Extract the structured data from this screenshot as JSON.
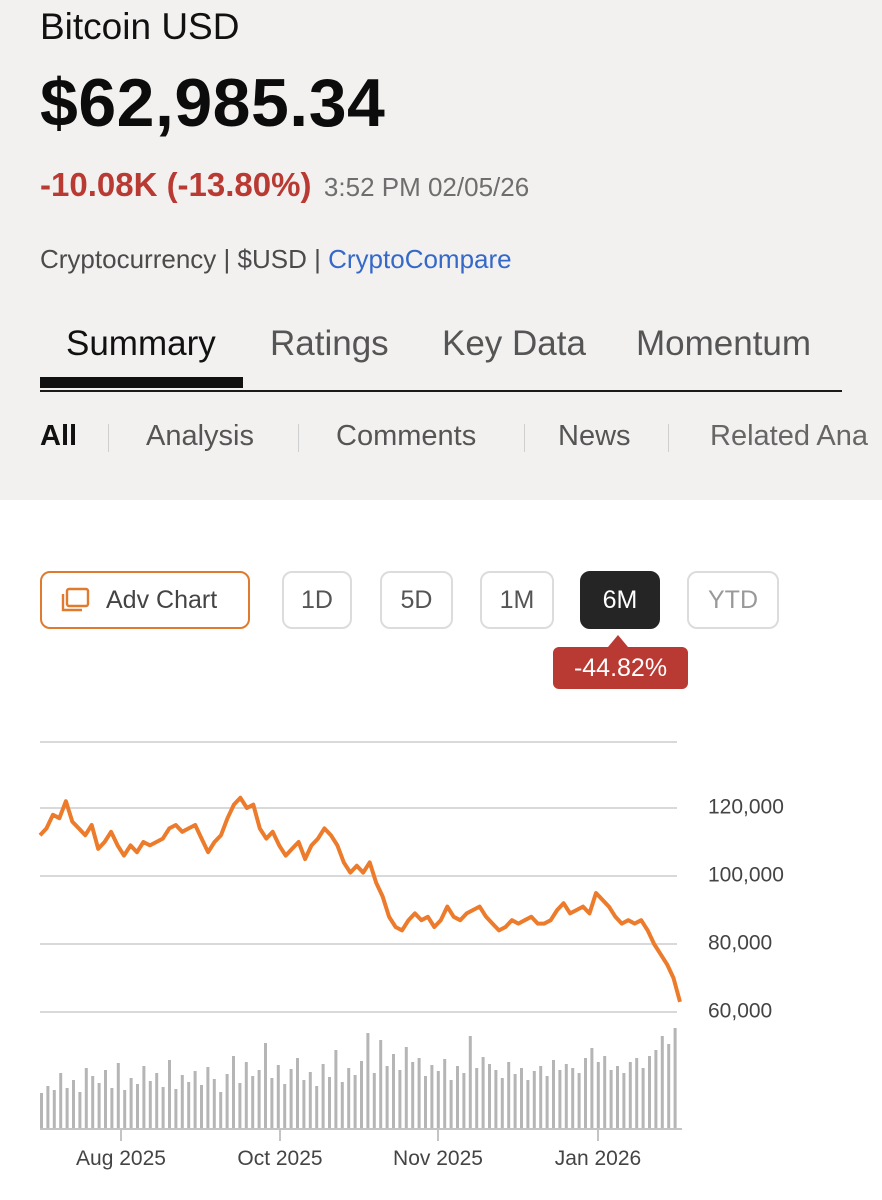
{
  "header": {
    "asset_name": "Bitcoin USD",
    "price": "$62,985.34",
    "change": "-10.08K (-13.80%)",
    "timestamp": "3:52 PM 02/05/26",
    "category": "Cryptocurrency",
    "currency": "$USD",
    "source": "CryptoCompare",
    "separator": "|"
  },
  "tabs": [
    {
      "label": "Summary",
      "active": true
    },
    {
      "label": "Ratings"
    },
    {
      "label": "Key Data"
    },
    {
      "label": "Momentum"
    }
  ],
  "subtabs": [
    {
      "label": "All",
      "active": true
    },
    {
      "label": "Analysis"
    },
    {
      "label": "Comments"
    },
    {
      "label": "News"
    },
    {
      "label": "Related Ana"
    }
  ],
  "range_controls": {
    "adv_chart_label": "Adv Chart",
    "adv_chart_icon": "chart-window-icon",
    "ranges": [
      "1D",
      "5D",
      "1M",
      "6M",
      "YTD"
    ],
    "selected": "6M",
    "period_change": "-44.82%"
  },
  "colors": {
    "negative": "#b93a33",
    "accent": "#e07a2e",
    "link": "#3568c8",
    "line": "#ec7b2c"
  },
  "chart_data": {
    "type": "line",
    "series": [
      {
        "values": [
          112000,
          114000,
          118000,
          117000,
          122000,
          116000,
          114000,
          112000,
          115000,
          108000,
          110000,
          113000,
          109000,
          106000,
          109000,
          107000,
          110000,
          109000,
          110000,
          111000,
          114000,
          115000,
          113000,
          114000,
          115000,
          111000,
          107000,
          110000,
          112000,
          117000,
          121000,
          123000,
          120000,
          121000,
          114000,
          111000,
          113000,
          109000,
          106000,
          108000,
          110000,
          105000,
          109000,
          111000,
          114000,
          112000,
          109000,
          104000,
          101000,
          103000,
          101000,
          104000,
          98000,
          94000,
          88000,
          85000,
          84000,
          87000,
          89000,
          87000,
          88000,
          85000,
          87000,
          91000,
          88000,
          87000,
          89000,
          90000,
          91000,
          88000,
          86000,
          84000,
          85000,
          87000,
          86000,
          87000,
          88000,
          86000,
          86000,
          87000,
          90000,
          92000,
          89000,
          90000,
          91000,
          89000,
          95000,
          93000,
          91000,
          88000,
          86000,
          87000,
          86000,
          87000,
          84000,
          80000,
          77000,
          74000,
          70000,
          62985
        ]
      }
    ],
    "volume": [
      35,
      42,
      38,
      55,
      40,
      48,
      36,
      60,
      52,
      45,
      58,
      40,
      65,
      38,
      50,
      44,
      62,
      47,
      55,
      41,
      68,
      39,
      53,
      46,
      57,
      43,
      61,
      49,
      36,
      54,
      72,
      45,
      66,
      52,
      58,
      85,
      50,
      63,
      44,
      59,
      70,
      48,
      56,
      42,
      64,
      51,
      78,
      46,
      60,
      53,
      67,
      95,
      55,
      88,
      62,
      74,
      58,
      81,
      66,
      70,
      52,
      63,
      57,
      69,
      48,
      62,
      55,
      92,
      60,
      71,
      64,
      58,
      50,
      66,
      54,
      60,
      48,
      57,
      62,
      52,
      68,
      58,
      64,
      60,
      55,
      70,
      80,
      66,
      72,
      58,
      62,
      55,
      66,
      70,
      60,
      72,
      78,
      92,
      84,
      100
    ],
    "x_ticks": [
      "Aug 2025",
      "Oct 2025",
      "Nov 2025",
      "Jan 2026"
    ],
    "y_ticks": [
      "120,000",
      "100,000",
      "80,000",
      "60,000"
    ],
    "ylim": [
      60000,
      130000
    ],
    "grid": true
  }
}
